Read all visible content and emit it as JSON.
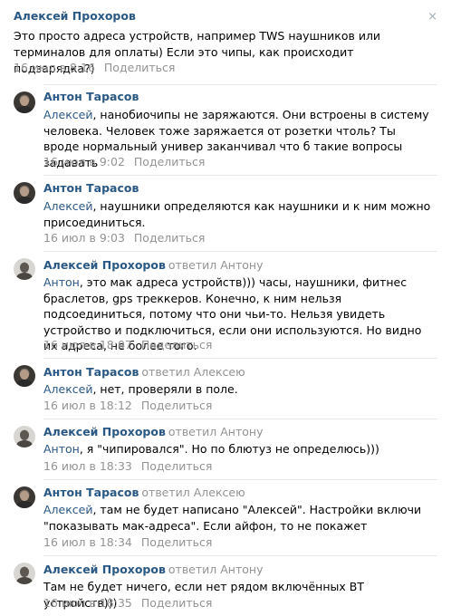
{
  "main": {
    "author": "Алексей Прохоров",
    "text": "Это просто адреса устройств, например TWS наушников или терминалов для оплаты) Если это чипы, как происходит подзарядка?)",
    "date": "16 июл в 8:16",
    "share": "Поделиться",
    "close_icon": "×"
  },
  "replies": [
    {
      "author": "Антон Тарасов",
      "replied_to": "",
      "mention": "Алексей",
      "text": ", нанобиочипы не заряжаются. Они встроены в систему человека. Человек тоже заряжается от розетки чтоль? Ты вроде нормальный универ заканчивал что б такие вопросы задавать",
      "date": "16 июл в 9:02",
      "share": "Поделиться"
    },
    {
      "author": "Антон Тарасов",
      "replied_to": "",
      "mention": "Алексей",
      "text": ", наушники определяются как наушники и к ним можно присоединиться.",
      "date": "16 июл в 9:03",
      "share": "Поделиться"
    },
    {
      "author": "Алексей Прохоров",
      "replied_to": "ответил Антону",
      "mention": "Антон",
      "text": ", это мак адреса устройств))) часы, наушники, фитнес браслетов, gps треккеров. Конечно, к ним нельзя подсоединиться, потому что они чьи-то. Нельзя увидеть устройство и подключиться, если они используются. Но видно их адреса, не более того.",
      "date": "16 июл в 18:07",
      "share": "Поделиться"
    },
    {
      "author": "Антон Тарасов",
      "replied_to": "ответил Алексею",
      "mention": "Алексей",
      "text": ", нет, проверяли в поле.",
      "date": "16 июл в 18:12",
      "share": "Поделиться"
    },
    {
      "author": "Алексей Прохоров",
      "replied_to": "ответил Антону",
      "mention": "Антон",
      "text": ", я \"чипировался\". Но по блютуз не определюсь)))",
      "date": "16 июл в 18:33",
      "share": "Поделиться"
    },
    {
      "author": "Антон Тарасов",
      "replied_to": "ответил Алексею",
      "mention": "Алексей",
      "text": ", там не будет написано \"Алексей\". Настройки включи \"показывать мак-адреса\". Если айфон, то не покажет",
      "date": "16 июл в 18:34",
      "share": "Поделиться"
    },
    {
      "author": "Алексей Прохоров",
      "replied_to": "ответил Антону",
      "mention": "",
      "text": "Там не будет ничего, если нет рядом включённых BT устройств)))",
      "date": "16 июл в 18:35",
      "share": "Поделиться"
    }
  ]
}
